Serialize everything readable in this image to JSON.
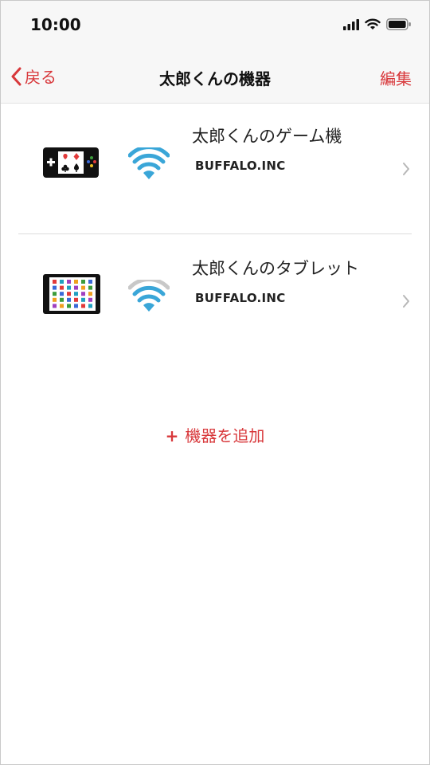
{
  "status_bar": {
    "time": "10:00"
  },
  "nav": {
    "back_label": "戻る",
    "title": "太郎くんの機器",
    "edit_label": "編集"
  },
  "devices": [
    {
      "name": "太郎くんのゲーム機",
      "maker": "BUFFALO.INC",
      "icon": "game-console-icon",
      "signal": "full"
    },
    {
      "name": "太郎くんのタブレット",
      "maker": "BUFFALO.INC",
      "icon": "tablet-icon",
      "signal": "partial"
    }
  ],
  "actions": {
    "add_device_plus": "+",
    "add_device_label": "機器を追加"
  },
  "colors": {
    "accent": "#d8383b",
    "wifi": "#3aa6d8",
    "wifi_inactive": "#c8c8c8"
  }
}
